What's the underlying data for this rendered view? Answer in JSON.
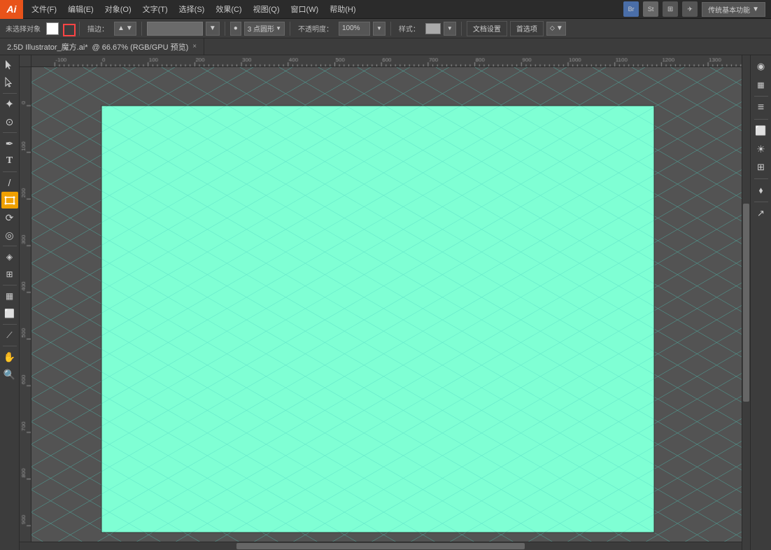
{
  "app": {
    "logo": "Ai",
    "title": "Adobe Illustrator"
  },
  "menubar": {
    "items": [
      {
        "label": "文件(F)"
      },
      {
        "label": "编辑(E)"
      },
      {
        "label": "对象(O)"
      },
      {
        "label": "文字(T)"
      },
      {
        "label": "选择(S)"
      },
      {
        "label": "效果(C)"
      },
      {
        "label": "视图(Q)"
      },
      {
        "label": "窗口(W)"
      },
      {
        "label": "帮助(H)"
      }
    ],
    "bridge_label": "Br",
    "stock_label": "St",
    "workspace_label": "传统基本功能",
    "workspace_arrow": "▼"
  },
  "toolbar": {
    "no_selection": "未选择对象",
    "stroke_label": "描边：",
    "stroke_value": "",
    "point_label": "3 点圆形",
    "opacity_label": "不透明度：",
    "opacity_value": "100%",
    "style_label": "样式：",
    "doc_settings_label": "文档设置",
    "preferences_label": "首选项",
    "arrangement_arrow": "⬦"
  },
  "tab": {
    "title": "2.5D Illustrator_魔方.ai*",
    "subtitle": "@ 66.67% (RGB/GPU 预览)",
    "close": "×"
  },
  "ruler": {
    "top_marks": [
      "-100",
      "0",
      "100",
      "200",
      "300",
      "400",
      "500",
      "600",
      "700",
      "800",
      "900",
      "1000",
      "1100",
      "1200",
      "1300"
    ],
    "left_marks": [
      "0",
      "100",
      "200",
      "300",
      "400",
      "500",
      "600",
      "700",
      "800",
      "900"
    ]
  },
  "tools": {
    "left": [
      {
        "name": "selection-tool",
        "icon": "▶",
        "active": false
      },
      {
        "name": "direct-selection-tool",
        "icon": "↖",
        "active": false
      },
      {
        "name": "magic-wand-tool",
        "icon": "✦",
        "active": false
      },
      {
        "name": "lasso-tool",
        "icon": "⊙",
        "active": false
      },
      {
        "name": "pen-tool",
        "icon": "✒",
        "active": false
      },
      {
        "name": "type-tool",
        "icon": "T",
        "active": false
      },
      {
        "name": "line-tool",
        "icon": "\\",
        "active": false
      },
      {
        "name": "transform-tool",
        "icon": "⬜",
        "active": true
      },
      {
        "name": "paint-brush-tool",
        "icon": "⟳",
        "active": false
      },
      {
        "name": "rotate-tool",
        "icon": "◎",
        "active": false
      },
      {
        "name": "blend-tool",
        "icon": "◈",
        "active": false
      },
      {
        "name": "symbol-tool",
        "icon": "⊞",
        "active": false
      },
      {
        "name": "column-graph-tool",
        "icon": "📊",
        "active": false
      },
      {
        "name": "artboard-tool",
        "icon": "⬜",
        "active": false
      },
      {
        "name": "slice-tool",
        "icon": "⟋",
        "active": false
      },
      {
        "name": "hand-tool",
        "icon": "🖐",
        "active": false
      },
      {
        "name": "zoom-tool",
        "icon": "🔍",
        "active": false
      }
    ]
  },
  "right_panel": {
    "buttons": [
      {
        "name": "color-btn",
        "icon": "◉"
      },
      {
        "name": "gradient-btn",
        "icon": "▦"
      },
      {
        "name": "appearance-btn",
        "icon": "≡"
      },
      {
        "name": "transform-btn",
        "icon": "⬜"
      },
      {
        "name": "align-btn",
        "icon": "☀"
      },
      {
        "name": "pathfinder-btn",
        "icon": "⊞"
      },
      {
        "name": "layers-btn",
        "icon": "⬧"
      },
      {
        "name": "export-btn",
        "icon": "↗"
      }
    ]
  },
  "canvas": {
    "background_color": "#535353",
    "artboard_color": "#7fffd4",
    "grid_color": "#4dd0c0"
  }
}
